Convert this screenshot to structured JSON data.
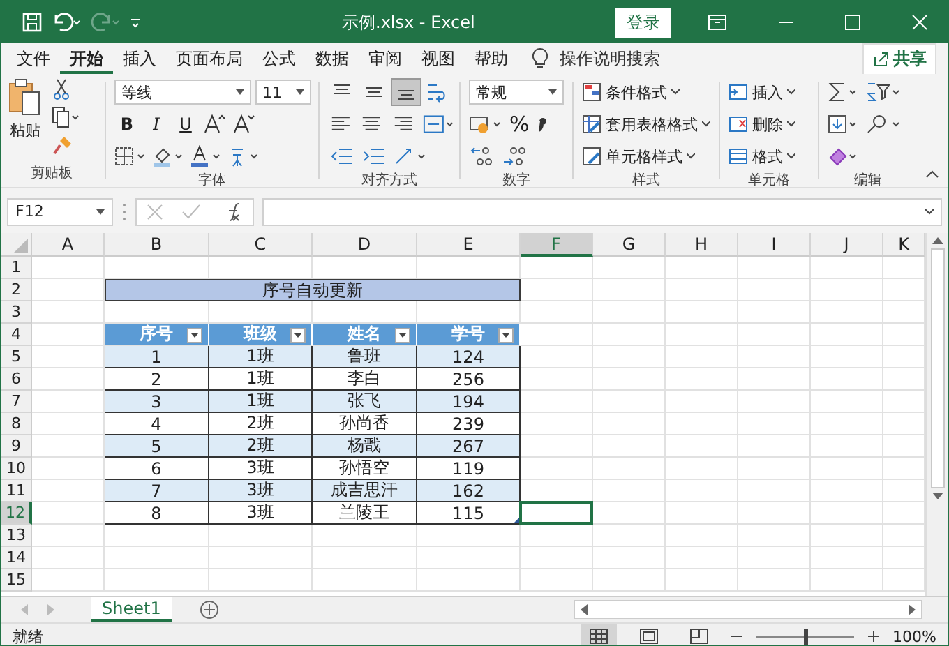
{
  "window": {
    "title": "示例.xlsx  -  Excel",
    "sign_in": "登录"
  },
  "tabs": [
    {
      "label": "文件",
      "selected": false
    },
    {
      "label": "开始",
      "selected": true
    },
    {
      "label": "插入",
      "selected": false
    },
    {
      "label": "页面布局",
      "selected": false
    },
    {
      "label": "公式",
      "selected": false
    },
    {
      "label": "数据",
      "selected": false
    },
    {
      "label": "审阅",
      "selected": false
    },
    {
      "label": "视图",
      "selected": false
    },
    {
      "label": "帮助",
      "selected": false
    }
  ],
  "search": {
    "placeholder": "操作说明搜索"
  },
  "share_button": "共享",
  "ribbon": {
    "clipboard": {
      "paste": "粘贴",
      "label": "剪贴板"
    },
    "font": {
      "font_name": "等线",
      "font_size": "11",
      "style_buttons": [
        "B",
        "I",
        "U"
      ],
      "label": "字体"
    },
    "alignment": {
      "vertical_align": [
        {
          "selected": false
        },
        {
          "selected": false
        },
        {
          "selected": true
        }
      ],
      "label": "对齐方式"
    },
    "number": {
      "format": "常规",
      "percent": "%",
      "label": "数字"
    },
    "styles": {
      "items": [
        "条件格式",
        "套用表格格式",
        "单元格样式"
      ],
      "label": "样式"
    },
    "cells": {
      "items": [
        "插入",
        "删除",
        "格式"
      ],
      "label": "单元格"
    },
    "editing": {
      "label": "编辑"
    }
  },
  "name_box": "F12",
  "sheet": {
    "columns": [
      {
        "label": "A",
        "selected": false
      },
      {
        "label": "B",
        "selected": false
      },
      {
        "label": "C",
        "selected": false
      },
      {
        "label": "D",
        "selected": false
      },
      {
        "label": "E",
        "selected": false
      },
      {
        "label": "F",
        "selected": true
      },
      {
        "label": "G",
        "selected": false
      },
      {
        "label": "H",
        "selected": false
      },
      {
        "label": "I",
        "selected": false
      },
      {
        "label": "J",
        "selected": false
      },
      {
        "label": "K",
        "selected": false
      }
    ],
    "rows": [
      {
        "label": "1",
        "selected": false
      },
      {
        "label": "2",
        "selected": false
      },
      {
        "label": "3",
        "selected": false
      },
      {
        "label": "4",
        "selected": false
      },
      {
        "label": "5",
        "selected": false
      },
      {
        "label": "6",
        "selected": false
      },
      {
        "label": "7",
        "selected": false
      },
      {
        "label": "8",
        "selected": false
      },
      {
        "label": "9",
        "selected": false
      },
      {
        "label": "10",
        "selected": false
      },
      {
        "label": "11",
        "selected": false
      },
      {
        "label": "12",
        "selected": true
      },
      {
        "label": "13",
        "selected": false
      },
      {
        "label": "14",
        "selected": false
      },
      {
        "label": "15",
        "selected": false
      }
    ],
    "title_cell": "序号自动更新",
    "table": {
      "headers": [
        "序号",
        "班级",
        "姓名",
        "学号"
      ],
      "rows": [
        [
          "1",
          "1班",
          "鲁班",
          "124"
        ],
        [
          "2",
          "1班",
          "李白",
          "256"
        ],
        [
          "3",
          "1班",
          "张飞",
          "194"
        ],
        [
          "4",
          "2班",
          "孙尚香",
          "239"
        ],
        [
          "5",
          "2班",
          "杨戬",
          "267"
        ],
        [
          "6",
          "3班",
          "孙悟空",
          "119"
        ],
        [
          "7",
          "3班",
          "成吉思汗",
          "162"
        ],
        [
          "8",
          "3班",
          "兰陵王",
          "115"
        ]
      ]
    }
  },
  "sheet_tabs": [
    {
      "label": "Sheet1",
      "selected": true
    }
  ],
  "status": "就绪",
  "view_buttons": [
    {
      "selected": true
    },
    {
      "selected": false
    },
    {
      "selected": false
    }
  ],
  "zoom": {
    "level": 0.5,
    "reading": "100%"
  }
}
